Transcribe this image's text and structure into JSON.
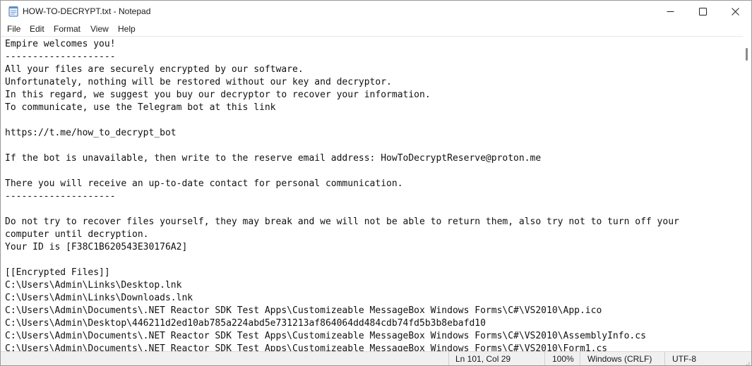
{
  "window": {
    "title": "HOW-TO-DECRYPT.txt - Notepad"
  },
  "menu": {
    "items": [
      "File",
      "Edit",
      "Format",
      "View",
      "Help"
    ]
  },
  "editor": {
    "lines": [
      "Empire welcomes you!",
      "--------------------",
      "All your files are securely encrypted by our software.",
      "Unfortunately, nothing will be restored without our key and decryptor.",
      "In this regard, we suggest you buy our decryptor to recover your information.",
      "To communicate, use the Telegram bot at this link",
      "",
      "https://t.me/how_to_decrypt_bot",
      "",
      "If the bot is unavailable, then write to the reserve email address: HowToDecryptReserve@proton.me",
      "",
      "There you will receive an up-to-date contact for personal communication.",
      "--------------------",
      "",
      "Do not try to recover files yourself, they may break and we will not be able to return them, also try not to turn off your",
      "computer until decryption.",
      "Your ID is [F38C1B620543E30176A2]",
      "",
      "[[Encrypted Files]]",
      "C:\\Users\\Admin\\Links\\Desktop.lnk",
      "C:\\Users\\Admin\\Links\\Downloads.lnk",
      "C:\\Users\\Admin\\Documents\\.NET Reactor SDK Test Apps\\Customizeable MessageBox Windows Forms\\C#\\VS2010\\App.ico",
      "C:\\Users\\Admin\\Desktop\\446211d2ed10ab785a224abd5e731213af864064dd484cdb74fd5b3b8ebafd10",
      "C:\\Users\\Admin\\Documents\\.NET Reactor SDK Test Apps\\Customizeable MessageBox Windows Forms\\C#\\VS2010\\AssemblyInfo.cs",
      "C:\\Users\\Admin\\Documents\\.NET Reactor SDK Test Apps\\Customizeable MessageBox Windows Forms\\C#\\VS2010\\Form1.cs"
    ]
  },
  "status": {
    "position": "Ln 101, Col 29",
    "zoom": "100%",
    "line_ending": "Windows (CRLF)",
    "encoding": "UTF-8"
  },
  "icons": {
    "app": "notepad-icon",
    "minimize": "minimize-icon",
    "maximize": "maximize-icon",
    "close": "close-icon",
    "grip": "resize-grip-icon"
  }
}
